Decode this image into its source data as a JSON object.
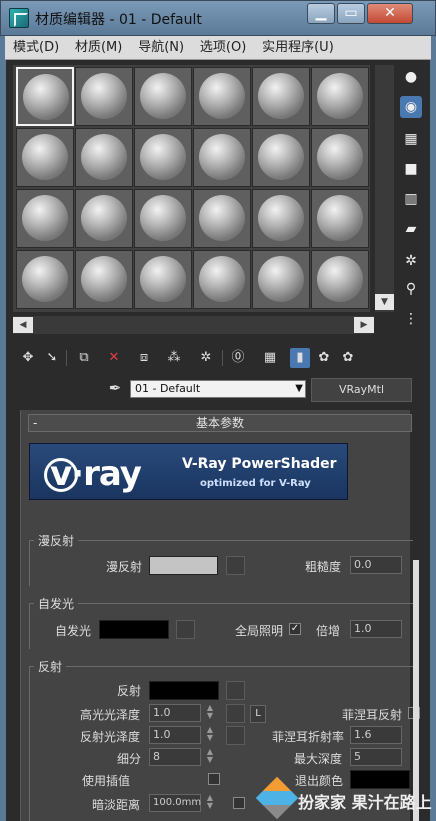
{
  "window": {
    "title": "材质编辑器 - 01 - Default",
    "minimize": "▁",
    "maximize": "▭",
    "close": "✕"
  },
  "menu": [
    "模式(D)",
    "材质(M)",
    "导航(N)",
    "选项(O)",
    "实用程序(U)"
  ],
  "material": {
    "name": "01 - Default",
    "type": "VRayMtl"
  },
  "rollout": {
    "minus": "-",
    "title": "基本参数"
  },
  "banner": {
    "logo": "v·ray",
    "title": "V-Ray PowerShader",
    "subtitle": "optimized for V-Ray"
  },
  "diffuse": {
    "group": "漫反射",
    "label": "漫反射",
    "roughness_label": "粗糙度",
    "roughness": "0.0",
    "color": "#c4c4c4"
  },
  "self_illum": {
    "group": "自发光",
    "label": "自发光",
    "gi_label": "全局照明",
    "gi_checked": "✓",
    "mult_label": "倍增",
    "mult": "1.0",
    "color": "#000000"
  },
  "reflection": {
    "group": "反射",
    "label": "反射",
    "color": "#000000",
    "hilight_gloss_label": "高光光泽度",
    "hilight_gloss": "1.0",
    "lock": "L",
    "fresnel_label": "菲涅耳反射",
    "refl_gloss_label": "反射光泽度",
    "refl_gloss": "1.0",
    "fresnel_ior_label": "菲涅耳折射率",
    "fresnel_ior": "1.6",
    "subdivs_label": "细分",
    "subdivs": "8",
    "max_depth_label": "最大深度",
    "max_depth": "5",
    "use_interp_label": "使用插值",
    "exit_color_label": "退出颜色",
    "dim_dist_label": "暗淡距离",
    "dim_dist": "100.0mm"
  },
  "watermark": {
    "text": "扮家家 果汁在路上"
  }
}
